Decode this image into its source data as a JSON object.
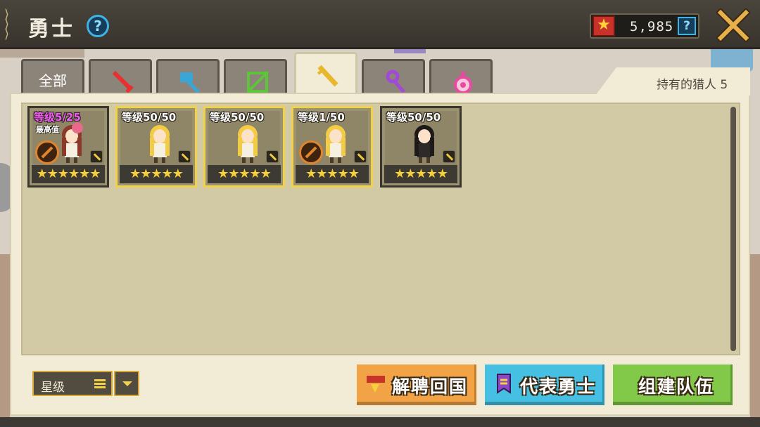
{
  "header": {
    "title": "勇士",
    "help_label": "?",
    "currency_amount": "5,985",
    "currency_help_label": "?"
  },
  "tabs": [
    {
      "label": "全部",
      "icon": "all-icon",
      "active": false
    },
    {
      "label": "",
      "icon": "sword-icon",
      "active": false,
      "color": "#e8302e"
    },
    {
      "label": "",
      "icon": "hammer-icon",
      "active": false,
      "color": "#3aa6d8"
    },
    {
      "label": "",
      "icon": "bow-icon",
      "active": false,
      "color": "#5ec43a"
    },
    {
      "label": "",
      "icon": "gun-icon",
      "active": true,
      "color": "#e8b82a"
    },
    {
      "label": "",
      "icon": "staff-icon",
      "active": false,
      "color": "#a24ad8"
    },
    {
      "label": "",
      "icon": "orb-icon",
      "active": false,
      "color": "#e84aa2"
    }
  ],
  "owned_label": "持有的猎人 5",
  "heroes": [
    {
      "level": "等级5/25",
      "max_tag": "最高值",
      "stars": "★★★★★★",
      "shield": true,
      "gold": false,
      "purple": true,
      "hair": "#8b3a2a",
      "hat": "#e86a8a"
    },
    {
      "level": "等级50/50",
      "max_tag": "",
      "stars": "★★★★★",
      "shield": false,
      "gold": true,
      "purple": false,
      "hair": "#f2cc44",
      "hat": ""
    },
    {
      "level": "等级50/50",
      "max_tag": "",
      "stars": "★★★★★",
      "shield": false,
      "gold": true,
      "purple": false,
      "hair": "#f2cc44",
      "hat": ""
    },
    {
      "level": "等级1/50",
      "max_tag": "",
      "stars": "★★★★★",
      "shield": true,
      "gold": true,
      "purple": false,
      "hair": "#f2cc44",
      "hat": ""
    },
    {
      "level": "等级50/50",
      "max_tag": "",
      "stars": "★★★★★",
      "shield": false,
      "gold": false,
      "purple": false,
      "hair": "#1e1a1a",
      "hat": ""
    }
  ],
  "sort": {
    "label": "星级"
  },
  "buttons": {
    "dismiss": "解聘回国",
    "representative": "代表勇士",
    "form_team": "组建队伍"
  }
}
